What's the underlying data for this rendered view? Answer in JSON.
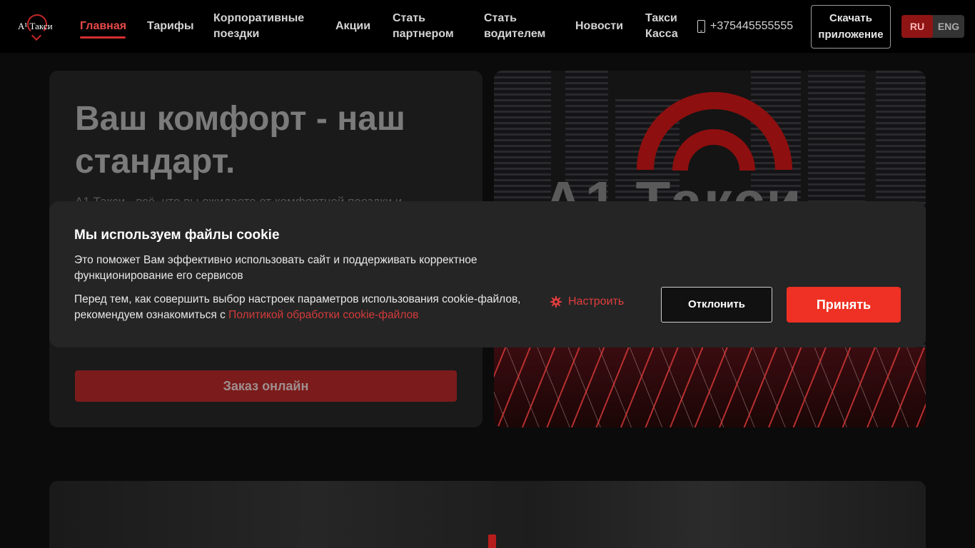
{
  "header": {
    "logo_text": "А¹ Такси",
    "nav": [
      {
        "label": "Главная",
        "active": true
      },
      {
        "label": "Тарифы"
      },
      {
        "label": "Корпоративные поездки"
      },
      {
        "label": "Акции"
      },
      {
        "label": "Стать партнером"
      },
      {
        "label": "Стать водителем"
      },
      {
        "label": "Новости"
      },
      {
        "label": "Такси Касса"
      }
    ],
    "phone": "+375445555555",
    "download_label": "Скачать приложение",
    "lang": {
      "ru": "RU",
      "en": "ENG",
      "selected": "RU"
    }
  },
  "hero": {
    "title": "Ваш комфорт - наш стандарт.",
    "subtitle": "А1 Такси - всё, что вы ожидаете от комфортной поездки и",
    "order_button": "Заказ онлайн",
    "image_text": "А1 Такси"
  },
  "cookie": {
    "title": "Мы используем файлы cookie",
    "text1": "Это поможет Вам эффективно использовать сайт и поддерживать корректное функционирование его сервисов",
    "text2": "Перед тем, как совершить выбор настроек параметров использования cookie-файлов, рекомендуем ознакомиться с",
    "link": "Политикой обработки cookie-файлов",
    "settings": "Настроить",
    "decline": "Отклонить",
    "accept": "Принять"
  },
  "colors": {
    "accent": "#ee3124",
    "header_bg": "#000000",
    "page_bg": "#0b0b0b"
  }
}
